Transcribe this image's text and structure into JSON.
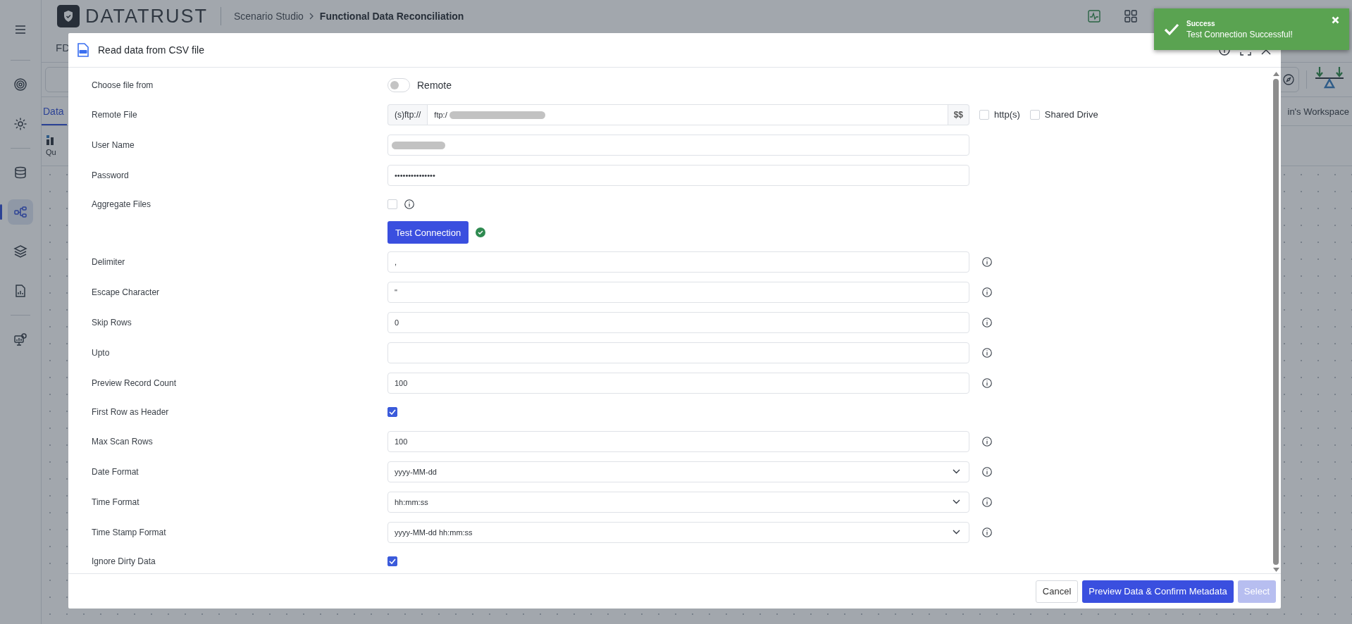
{
  "app": {
    "brand": "DATATRUST",
    "breadcrumb": [
      {
        "text": "Scenario Studio"
      },
      {
        "text": "Functional Data Reconciliation"
      }
    ],
    "project": "FD",
    "tab": "Data",
    "ribbon_item": "Qu",
    "workspace": "in's Workspace"
  },
  "sidebar": {
    "items": [
      {
        "selected": false
      },
      {
        "selected": false
      },
      {
        "selected": false
      },
      {
        "selected": true
      },
      {
        "selected": false
      },
      {
        "selected": false
      },
      {
        "selected": false
      }
    ]
  },
  "dialog": {
    "title": "Read data from CSV file",
    "fields": [
      {
        "label": "Choose file from",
        "kind": "toggle",
        "on": false,
        "text": "Remote",
        "info": false
      },
      {
        "label": "Remote File",
        "kind": "url",
        "prefix": "(s)ftp://",
        "value": "ftp:/",
        "redacted": true,
        "suffix": "$$",
        "info": false,
        "options": [
          {
            "label": "http(s)",
            "checked": false
          },
          {
            "label": "Shared Drive",
            "checked": false
          }
        ]
      },
      {
        "label": "User Name",
        "kind": "text",
        "redacted": true,
        "info": false
      },
      {
        "label": "Password",
        "kind": "text",
        "value": "•••••••••••••••",
        "redacted": false,
        "info": false
      },
      {
        "label": "Aggregate Files",
        "kind": "checkbox",
        "checked": false,
        "info": true
      },
      {
        "kind": "button",
        "text": "Test Connection",
        "verified": true,
        "info": false
      },
      {
        "label": "Delimiter",
        "kind": "text",
        "value": ",",
        "redacted": false,
        "info": true
      },
      {
        "label": "Escape Character",
        "kind": "text",
        "value": "\"",
        "redacted": false,
        "info": true
      },
      {
        "label": "Skip Rows",
        "kind": "text",
        "value": "0",
        "redacted": false,
        "info": true
      },
      {
        "label": "Upto",
        "kind": "text",
        "redacted": false,
        "info": true
      },
      {
        "label": "Preview Record Count",
        "kind": "text",
        "value": "100",
        "redacted": false,
        "info": true
      },
      {
        "label": "First Row as Header",
        "kind": "checkbox",
        "checked": true,
        "info": false
      },
      {
        "label": "Max Scan Rows",
        "kind": "text",
        "value": "100",
        "redacted": false,
        "info": true
      },
      {
        "label": "Date Format",
        "kind": "select",
        "value": "yyyy-MM-dd",
        "info": true
      },
      {
        "label": "Time Format",
        "kind": "select",
        "value": "hh:mm:ss",
        "info": true
      },
      {
        "label": "Time Stamp Format",
        "kind": "select",
        "value": "yyyy-MM-dd hh:mm:ss",
        "info": true
      },
      {
        "label": "Ignore Dirty Data",
        "kind": "checkbox",
        "checked": true,
        "info": false
      }
    ],
    "buttons": [
      {
        "label": "Cancel",
        "kind": "secondary",
        "disabled": false
      },
      {
        "label": "Preview Data & Confirm Metadata",
        "kind": "primary",
        "disabled": false
      },
      {
        "label": "Select",
        "kind": "primary",
        "disabled": true
      }
    ]
  },
  "toast": {
    "title": "Success",
    "message": "Test Connection Successful!"
  }
}
